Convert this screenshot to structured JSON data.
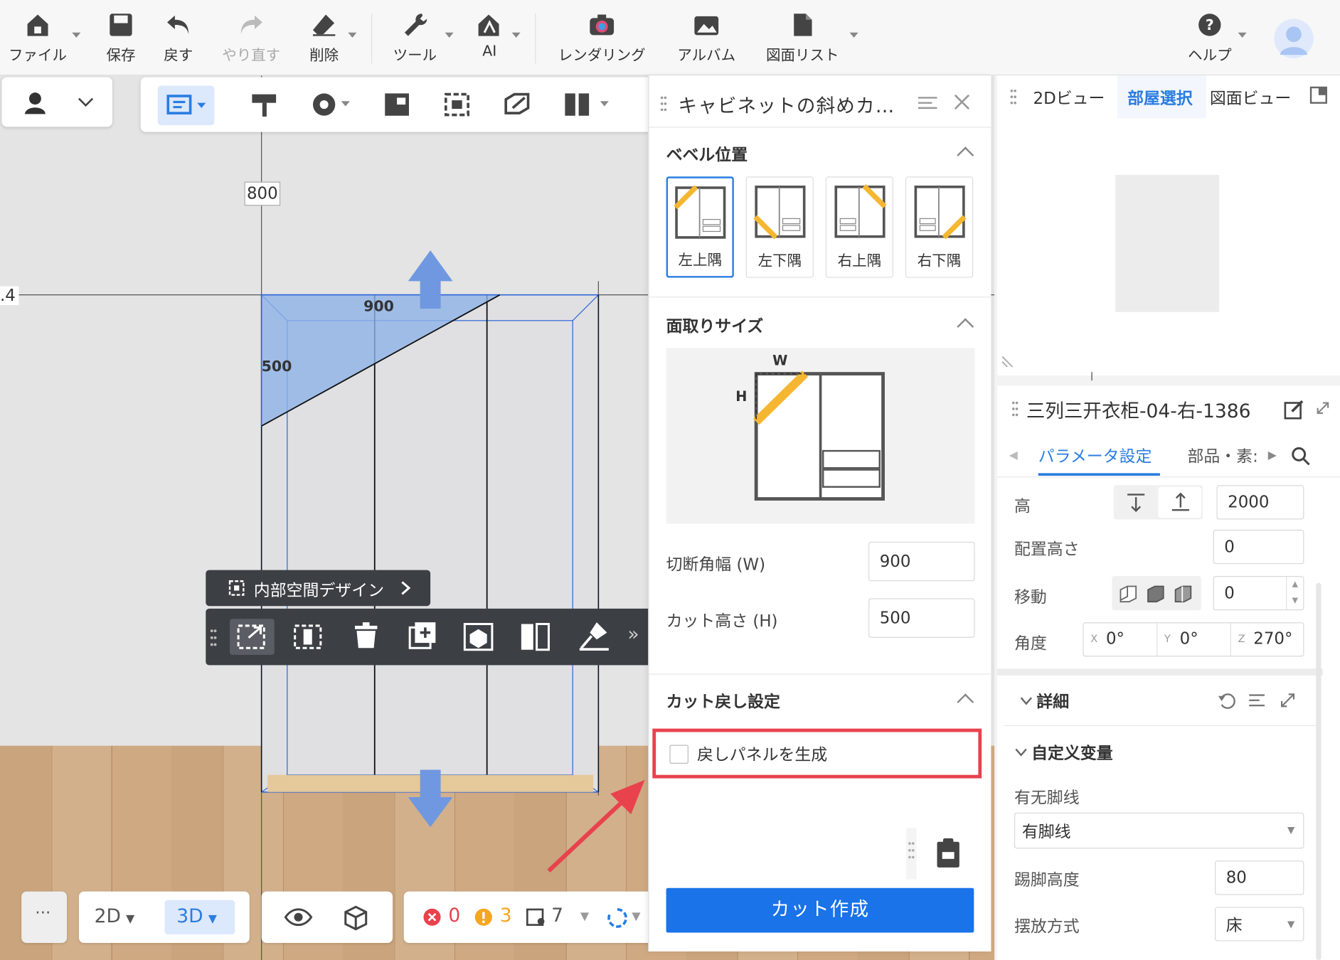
{
  "toolbar": {
    "file": "ファイル",
    "save": "保存",
    "undo": "戻す",
    "redo": "やり直す",
    "delete": "削除",
    "tools": "ツール",
    "ai": "AI",
    "rendering": "レンダリング",
    "album": "アルバム",
    "drawing_list": "図面リスト",
    "help": "ヘルプ"
  },
  "canvas": {
    "dim_top": "800",
    "dim_left": ".4",
    "dim_width": "900",
    "dim_height": "500",
    "interior_design_label": "内部空間デザイン"
  },
  "bottom_bar": {
    "more": "···",
    "view_2d": "2D",
    "view_3d": "3D",
    "errors": "0",
    "warnings": "3",
    "items": "7"
  },
  "panel": {
    "title": "キャビネットの斜めカ…",
    "bevel_position_title": "ベベル位置",
    "bevel_options": [
      "左上隅",
      "左下隅",
      "右上隅",
      "右下隅"
    ],
    "chamfer_size_title": "面取りサイズ",
    "diagram_w": "W",
    "diagram_h": "H",
    "cut_width_label": "切断角幅 (W)",
    "cut_width_value": "900",
    "cut_height_label": "カット高さ (H)",
    "cut_height_value": "500",
    "cut_back_title": "カット戻し設定",
    "generate_back_panel": "戻しパネルを生成",
    "create_cut_button": "カット作成"
  },
  "right_top": {
    "tab_2d": "2Dビュー",
    "tab_room": "部屋選択",
    "tab_drawing": "図面ビュー"
  },
  "right_bottom": {
    "title": "三列三开衣柜-04-右-1386",
    "tab_params": "パラメータ設定",
    "tab_parts": "部品・素:",
    "height_label": "高",
    "height_value": "2000",
    "placement_height_label": "配置高さ",
    "placement_height_value": "0",
    "move_label": "移動",
    "move_value": "0",
    "angle_label": "角度",
    "angle_x_prefix": "X",
    "angle_x": "0°",
    "angle_y_prefix": "Y",
    "angle_y": "0°",
    "angle_z_prefix": "Z",
    "angle_z": "270°",
    "details": "詳細",
    "custom_vars": "自定义变量",
    "baseline_label": "有无脚线",
    "baseline_value": "有脚线",
    "kick_height_label": "踢脚高度",
    "kick_height_value": "80",
    "placement_label": "摆放方式",
    "placement_value": "床"
  },
  "colors": {
    "accent": "#2a7de1",
    "button_blue": "#1a73e8",
    "highlight_red": "#e8424d",
    "bevel_yellow": "#f5b731",
    "cut_blue": "#8fb3e8"
  }
}
